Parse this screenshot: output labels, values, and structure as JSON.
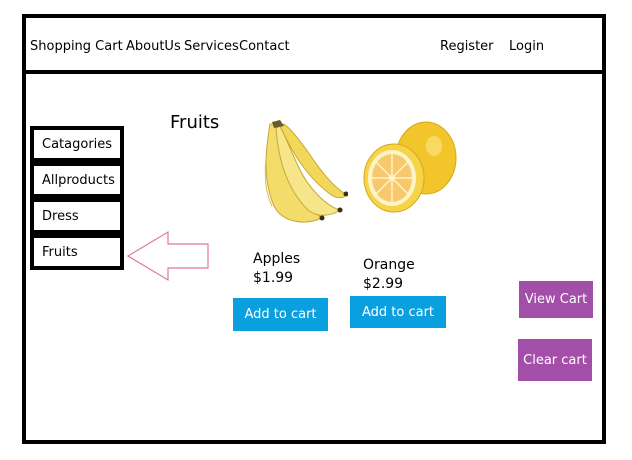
{
  "nav": {
    "shopping_cart": "Shopping Cart",
    "about_us": "AboutUs",
    "services": "Services",
    "contact": "Contact",
    "register": "Register",
    "login": "Login"
  },
  "sidebar": {
    "items": [
      {
        "label": "Catagories"
      },
      {
        "label": "Allproducts"
      },
      {
        "label": "Dress"
      },
      {
        "label": "Fruits"
      }
    ]
  },
  "main": {
    "category_title": "Fruits",
    "products": [
      {
        "name": "Apples",
        "price": "$1.99",
        "button": "Add to cart",
        "image": "banana-bunch"
      },
      {
        "name": "Orange",
        "price": "$2.99",
        "button": "Add to cart",
        "image": "grapefruit"
      }
    ]
  },
  "cart": {
    "view_label": "View Cart",
    "clear_label": "Clear cart"
  },
  "colors": {
    "add_button": "#0aa0e0",
    "cart_button": "#a34faa",
    "arrow_outline": "#e07a9a"
  }
}
